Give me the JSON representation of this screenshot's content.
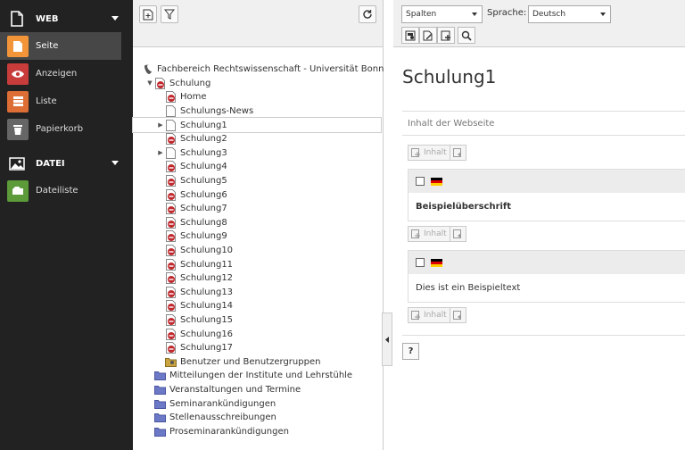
{
  "modules": {
    "web_group": "WEB",
    "web_items": [
      {
        "label": "Seite",
        "icon": "page-icon",
        "color": "#f29539",
        "active": true
      },
      {
        "label": "Anzeigen",
        "icon": "eye-icon",
        "color": "#c83c3c"
      },
      {
        "label": "Liste",
        "icon": "list-icon",
        "color": "#dc6e36"
      },
      {
        "label": "Papierkorb",
        "icon": "trash-icon",
        "color": "#666666"
      }
    ],
    "file_group": "DATEI",
    "file_items": [
      {
        "label": "Dateiliste",
        "icon": "filelist-icon",
        "color": "#5c9a3a"
      }
    ]
  },
  "tree": {
    "root": "Fachbereich Rechtswissenschaft - Universität Bonn",
    "nodes": [
      {
        "label": "Schulung",
        "level": 1,
        "icon": "page-restricted"
      },
      {
        "label": "Home",
        "level": 2,
        "icon": "page-restricted"
      },
      {
        "label": "Schulungs-News",
        "level": 2,
        "icon": "page"
      },
      {
        "label": "Schulung1",
        "level": 2,
        "icon": "page",
        "selected": true,
        "expandable": true
      },
      {
        "label": "Schulung2",
        "level": 2,
        "icon": "page-restricted"
      },
      {
        "label": "Schulung3",
        "level": 2,
        "icon": "page",
        "expandable": true
      },
      {
        "label": "Schulung4",
        "level": 2,
        "icon": "page-restricted"
      },
      {
        "label": "Schulung5",
        "level": 2,
        "icon": "page-restricted"
      },
      {
        "label": "Schulung6",
        "level": 2,
        "icon": "page-restricted"
      },
      {
        "label": "Schulung7",
        "level": 2,
        "icon": "page-restricted"
      },
      {
        "label": "Schulung8",
        "level": 2,
        "icon": "page-restricted"
      },
      {
        "label": "Schulung9",
        "level": 2,
        "icon": "page-restricted"
      },
      {
        "label": "Schulung10",
        "level": 2,
        "icon": "page-restricted"
      },
      {
        "label": "Schulung11",
        "level": 2,
        "icon": "page-restricted"
      },
      {
        "label": "Schulung12",
        "level": 2,
        "icon": "page-restricted"
      },
      {
        "label": "Schulung13",
        "level": 2,
        "icon": "page-restricted"
      },
      {
        "label": "Schulung14",
        "level": 2,
        "icon": "page-restricted"
      },
      {
        "label": "Schulung15",
        "level": 2,
        "icon": "page-restricted"
      },
      {
        "label": "Schulung16",
        "level": 2,
        "icon": "page-restricted"
      },
      {
        "label": "Schulung17",
        "level": 2,
        "icon": "page-restricted"
      },
      {
        "label": "Benutzer und Benutzergruppen",
        "level": 2,
        "icon": "sysfolder"
      },
      {
        "label": "Mitteilungen der Institute und Lehrstühle",
        "level": 1,
        "icon": "folder"
      },
      {
        "label": "Veranstaltungen und Termine",
        "level": 1,
        "icon": "folder"
      },
      {
        "label": "Seminarankündigungen",
        "level": 1,
        "icon": "folder"
      },
      {
        "label": "Stellenausschreibungen",
        "level": 1,
        "icon": "folder"
      },
      {
        "label": "Proseminarankündigungen",
        "level": 1,
        "icon": "folder"
      }
    ]
  },
  "main": {
    "view_select": "Spalten",
    "language_label": "Sprache:",
    "language_select": "Deutsch",
    "page_title": "Schulung1",
    "column_header": "Inhalt der Webseite",
    "new_content_label": "Inhalt",
    "elements": [
      {
        "text": "Beispielüberschrift",
        "bold": true
      },
      {
        "text": "Dies ist ein Beispieltext",
        "bold": false
      }
    ],
    "help_label": "?"
  }
}
